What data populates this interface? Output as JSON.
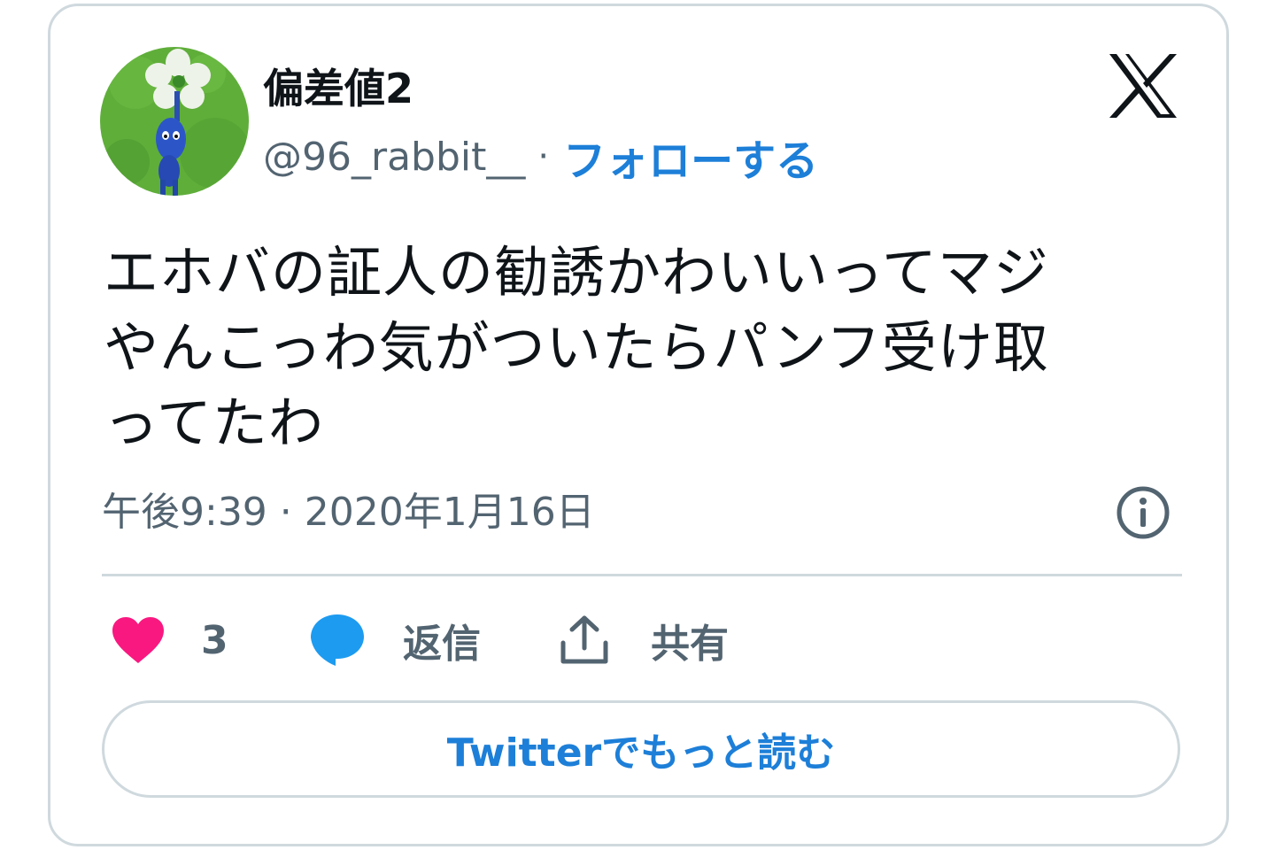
{
  "author": {
    "display_name": "偏差値2",
    "handle": "@96_rabbit__",
    "separator": "·",
    "follow_label": "フォローする"
  },
  "tweet": {
    "lines": [
      "エホバの証人の勧誘かわいいってマジ",
      "やんこっわ気がついたらパンフ受け取",
      "ってたわ"
    ],
    "timestamp": "午後9:39 · 2020年1月16日"
  },
  "actions": {
    "like_count": "3",
    "reply_label": "返信",
    "share_label": "共有"
  },
  "read_more_label": "Twitterでもっと読む",
  "icons": {
    "brand": "x-logo-icon",
    "info": "info-icon",
    "like": "heart-icon",
    "reply": "speech-bubble-icon",
    "share": "upload-share-icon"
  },
  "colors": {
    "link_blue": "#1d7fd8",
    "heart_pink": "#f91880",
    "reply_blue": "#1d9bf0",
    "muted_text": "#536471",
    "border": "#cfd9de"
  }
}
